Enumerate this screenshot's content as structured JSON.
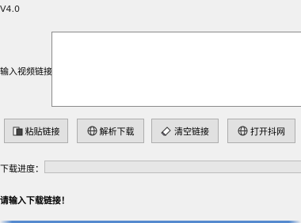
{
  "window": {
    "title": "V4.0"
  },
  "form": {
    "link_label": "输入视频链接",
    "link_value": ""
  },
  "buttons": {
    "paste": {
      "label": "粘贴链接",
      "icon": "paste-icon"
    },
    "parse": {
      "label": "解析下载",
      "icon": "globe-icon"
    },
    "clear": {
      "label": "清空链接",
      "icon": "eraser-icon"
    },
    "douyin": {
      "label": "打开抖网",
      "icon": "globe-icon"
    }
  },
  "progress": {
    "label": "下载进度：",
    "value": 0
  },
  "status": {
    "text": "请输入下载链接！"
  }
}
